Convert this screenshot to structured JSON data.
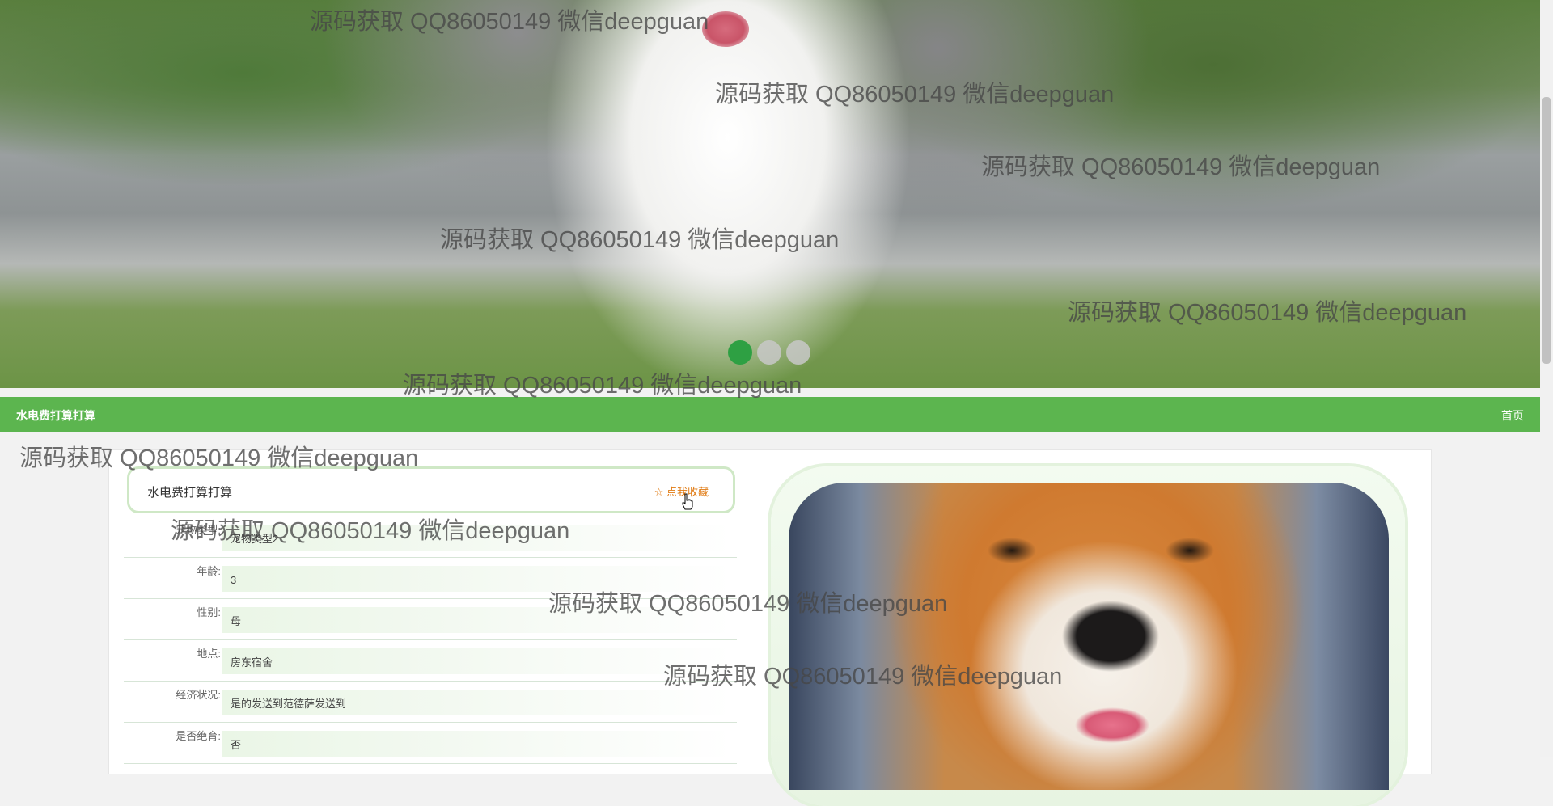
{
  "banner": {
    "slides": 3,
    "active_slide": 1
  },
  "nav": {
    "title": "水电费打算打算",
    "home": "首页"
  },
  "detail": {
    "title": "水电费打算打算",
    "favorite_label": "☆ 点我收藏",
    "fields": [
      {
        "label": "宠物类型:",
        "value": "宠物类型2"
      },
      {
        "label": "年龄:",
        "value": "3"
      },
      {
        "label": "性别:",
        "value": "母"
      },
      {
        "label": "地点:",
        "value": "房东宿舍"
      },
      {
        "label": "经济状况:",
        "value": "是的发送到范德萨发送到"
      },
      {
        "label": "是否绝育:",
        "value": "否"
      }
    ]
  },
  "watermark": {
    "text": "源码获取 QQ86050149 微信deepguan"
  },
  "colors": {
    "nav_green": "#5cb54f",
    "active_dot": "#2ea043",
    "favorite": "#e07b14"
  }
}
